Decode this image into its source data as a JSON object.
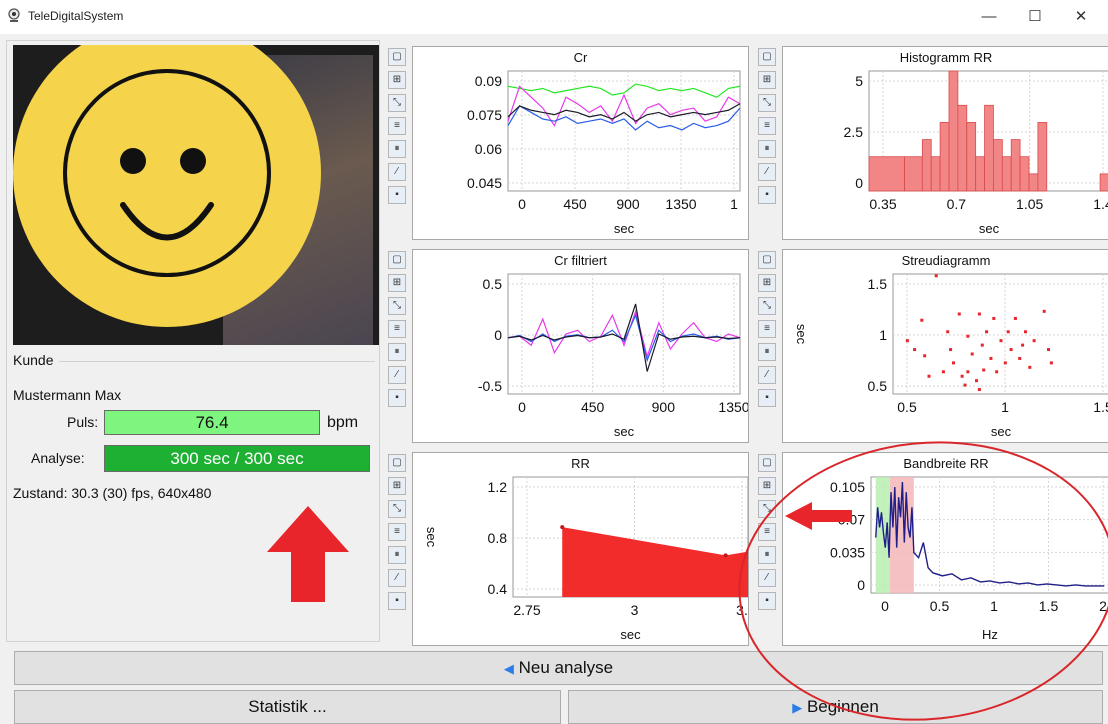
{
  "window": {
    "title": "TeleDigitalSystem",
    "minimize": "—",
    "maximize": "☐",
    "close": "✕"
  },
  "left": {
    "kunde_label": "Kunde",
    "name": "Mustermann Max",
    "puls_label": "Puls:",
    "puls_value": "76.4",
    "puls_unit": "bpm",
    "analyse_label": "Analyse:",
    "analyse_value": "300 sec / 300 sec",
    "analyse_progress": 1.0,
    "zustand": "Zustand: 30.3 (30) fps, 640x480"
  },
  "colors": {
    "accent": "#1db033",
    "puls_bg": "#7ef57e",
    "marker": "#e8252a",
    "smiley": "#f5d34a",
    "series_blue": "#1f1f8a"
  },
  "toolbar_icons": [
    "window-icon",
    "zoom-fit-icon",
    "zoom-reset-icon",
    "layers-icon",
    "pause-icon",
    "wand-icon",
    "save-icon"
  ],
  "buttons": {
    "neu_analyse": "Neu analyse",
    "statistik": "Statistik ...",
    "beginnen": "Beginnen"
  },
  "chart_data": [
    {
      "id": "cr",
      "type": "line",
      "title": "Cr",
      "xlabel": "sec",
      "ylabel": "",
      "xlim": [
        0,
        1500
      ],
      "ylim": [
        0.04,
        0.095
      ],
      "xticks": [
        "0",
        "450",
        "900",
        "1350",
        "1"
      ],
      "yticks": [
        "0.09",
        "0.075",
        "0.06",
        "0.045"
      ],
      "series": [
        {
          "color": "#22e822",
          "values": [
            0.088,
            0.087,
            0.086,
            0.087,
            0.085,
            0.086,
            0.087,
            0.088,
            0.087,
            0.084,
            0.085,
            0.089,
            0.088,
            0.086,
            0.087,
            0.086,
            0.087,
            0.085,
            0.083,
            0.087,
            0.088
          ]
        },
        {
          "color": "#e838e8",
          "values": [
            0.072,
            0.088,
            0.083,
            0.078,
            0.07,
            0.083,
            0.08,
            0.076,
            0.079,
            0.072,
            0.084,
            0.071,
            0.078,
            0.08,
            0.075,
            0.077,
            0.078,
            0.072,
            0.074,
            0.083,
            0.08
          ]
        },
        {
          "color": "#2a5ce8",
          "values": [
            0.07,
            0.079,
            0.076,
            0.073,
            0.072,
            0.074,
            0.071,
            0.072,
            0.073,
            0.071,
            0.073,
            0.068,
            0.072,
            0.069,
            0.07,
            0.068,
            0.071,
            0.069,
            0.07,
            0.072,
            0.078
          ]
        },
        {
          "color": "#1a1a2a",
          "values": [
            0.074,
            0.079,
            0.077,
            0.076,
            0.075,
            0.077,
            0.076,
            0.074,
            0.075,
            0.073,
            0.076,
            0.072,
            0.075,
            0.076,
            0.074,
            0.075,
            0.076,
            0.075,
            0.076,
            0.077,
            0.08
          ]
        }
      ]
    },
    {
      "id": "hist",
      "type": "bar",
      "title": "Histogramm RR",
      "xlabel": "sec",
      "ylabel": "",
      "xlim": [
        0.25,
        1.6
      ],
      "ylim": [
        0,
        7
      ],
      "xticks": [
        "0.35",
        "0.7",
        "1.05",
        "1.4"
      ],
      "yticks": [
        "5",
        "2.5",
        "0"
      ],
      "bins": [
        [
          0.25,
          0.45,
          2
        ],
        [
          0.45,
          0.55,
          2
        ],
        [
          0.55,
          0.6,
          3
        ],
        [
          0.6,
          0.65,
          2
        ],
        [
          0.65,
          0.7,
          4
        ],
        [
          0.7,
          0.75,
          7
        ],
        [
          0.75,
          0.8,
          5
        ],
        [
          0.8,
          0.85,
          4
        ],
        [
          0.85,
          0.9,
          2
        ],
        [
          0.9,
          0.95,
          5
        ],
        [
          0.95,
          1.0,
          3
        ],
        [
          1.0,
          1.05,
          2
        ],
        [
          1.05,
          1.1,
          3
        ],
        [
          1.1,
          1.15,
          2
        ],
        [
          1.15,
          1.2,
          1
        ],
        [
          1.2,
          1.25,
          4
        ],
        [
          1.25,
          1.55,
          0
        ],
        [
          1.55,
          1.6,
          1
        ]
      ]
    },
    {
      "id": "crf",
      "type": "line",
      "title": "Cr filtriert",
      "xlabel": "sec",
      "ylabel": "",
      "xlim": [
        0,
        1500
      ],
      "ylim": [
        -0.75,
        0.85
      ],
      "xticks": [
        "0",
        "450",
        "900",
        "1350"
      ],
      "yticks": [
        "0.5",
        "0",
        "-0.5"
      ],
      "series": [
        {
          "color": "#e838e8",
          "values": [
            0.0,
            0.02,
            -0.1,
            0.25,
            -0.2,
            0.05,
            0.1,
            -0.05,
            0.02,
            0.3,
            -0.1,
            0.35,
            -0.25,
            0.2,
            -0.15,
            0.05,
            0.2,
            0.0,
            -0.05,
            0.05,
            0.0
          ]
        },
        {
          "color": "#2a5ce8",
          "values": [
            0.0,
            0.03,
            -0.05,
            0.05,
            -0.05,
            0.02,
            0.04,
            0.0,
            0.01,
            0.1,
            -0.05,
            0.3,
            -0.3,
            0.1,
            -0.05,
            0.02,
            0.05,
            0.0,
            0.02,
            -0.02,
            0.0
          ]
        },
        {
          "color": "#1a1a2a",
          "values": [
            0.0,
            0.02,
            -0.03,
            0.03,
            -0.03,
            0.01,
            0.03,
            0.0,
            0.01,
            0.05,
            -0.02,
            0.45,
            -0.45,
            0.05,
            -0.02,
            0.01,
            0.02,
            0.0,
            0.01,
            -0.01,
            0.0
          ]
        }
      ]
    },
    {
      "id": "scatter",
      "type": "scatter",
      "title": "Streudiagramm",
      "xlabel": "sec",
      "ylabel": "sec",
      "xlim": [
        0.2,
        1.7
      ],
      "ylim": [
        0.35,
        1.7
      ],
      "xticks": [
        "0.5",
        "1",
        "1.5"
      ],
      "yticks": [
        "1.5",
        "1",
        "0.5"
      ],
      "points": [
        [
          0.5,
          1.68
        ],
        [
          0.3,
          0.95
        ],
        [
          0.35,
          0.85
        ],
        [
          0.42,
          0.78
        ],
        [
          0.45,
          0.55
        ],
        [
          0.55,
          0.6
        ],
        [
          0.58,
          1.05
        ],
        [
          0.6,
          0.85
        ],
        [
          0.62,
          0.7
        ],
        [
          0.66,
          1.25
        ],
        [
          0.7,
          0.45
        ],
        [
          0.72,
          0.6
        ],
        [
          0.72,
          1.0
        ],
        [
          0.75,
          0.8
        ],
        [
          0.78,
          0.5
        ],
        [
          0.8,
          1.25
        ],
        [
          0.8,
          0.4
        ],
        [
          0.82,
          0.9
        ],
        [
          0.85,
          1.05
        ],
        [
          0.88,
          0.75
        ],
        [
          0.9,
          1.2
        ],
        [
          0.92,
          0.6
        ],
        [
          0.95,
          0.95
        ],
        [
          0.98,
          0.7
        ],
        [
          1.0,
          1.05
        ],
        [
          1.02,
          0.85
        ],
        [
          1.05,
          1.2
        ],
        [
          1.08,
          0.75
        ],
        [
          1.1,
          0.9
        ],
        [
          1.15,
          0.65
        ],
        [
          1.18,
          0.95
        ],
        [
          1.25,
          1.28
        ],
        [
          1.28,
          0.85
        ],
        [
          1.3,
          0.7
        ],
        [
          0.4,
          1.18
        ],
        [
          0.68,
          0.55
        ],
        [
          0.83,
          0.62
        ],
        [
          1.12,
          1.05
        ]
      ]
    },
    {
      "id": "rr",
      "type": "area",
      "title": "RR",
      "xlabel": "sec",
      "ylabel": "sec",
      "xlim": [
        2.4,
        3.45
      ],
      "ylim": [
        0.05,
        1.32
      ],
      "xticks": [
        "2.75",
        "3",
        "3."
      ],
      "yticks": [
        "1.2",
        "0.8",
        "0.4"
      ],
      "x": [
        2.62,
        3.35,
        3.45
      ],
      "values": [
        0.79,
        0.49,
        0.53
      ]
    },
    {
      "id": "band",
      "type": "line",
      "title": "Bandbreite RR",
      "xlabel": "Hz",
      "ylabel": "",
      "xlim": [
        -0.05,
        2.45
      ],
      "ylim": [
        -0.005,
        0.11
      ],
      "xticks": [
        "0",
        "0.5",
        "1",
        "1.5",
        "2"
      ],
      "yticks": [
        "0.105",
        "0.07",
        "0.035",
        "0"
      ],
      "bands": [
        {
          "from": 0.0,
          "to": 0.15,
          "color": "#b9efb0"
        },
        {
          "from": 0.15,
          "to": 0.4,
          "color": "#f5b6b8"
        }
      ],
      "x": [
        0,
        0.02,
        0.04,
        0.06,
        0.08,
        0.1,
        0.12,
        0.14,
        0.16,
        0.18,
        0.2,
        0.22,
        0.24,
        0.26,
        0.28,
        0.3,
        0.32,
        0.34,
        0.36,
        0.38,
        0.4,
        0.45,
        0.5,
        0.55,
        0.6,
        0.7,
        0.8,
        0.9,
        1.0,
        1.1,
        1.2,
        1.3,
        1.4,
        1.5,
        1.6,
        1.7,
        1.8,
        1.9,
        2.0,
        2.1,
        2.2,
        2.3,
        2.4
      ],
      "values": [
        0.05,
        0.08,
        0.06,
        0.075,
        0.055,
        0.04,
        0.065,
        0.03,
        0.095,
        0.06,
        0.1,
        0.04,
        0.09,
        0.07,
        0.105,
        0.045,
        0.095,
        0.06,
        0.05,
        0.08,
        0.035,
        0.03,
        0.045,
        0.02,
        0.015,
        0.012,
        0.014,
        0.008,
        0.01,
        0.006,
        0.007,
        0.005,
        0.006,
        0.004,
        0.005,
        0.003,
        0.004,
        0.003,
        0.002,
        0.003,
        0.002,
        0.002,
        0.002
      ]
    }
  ]
}
